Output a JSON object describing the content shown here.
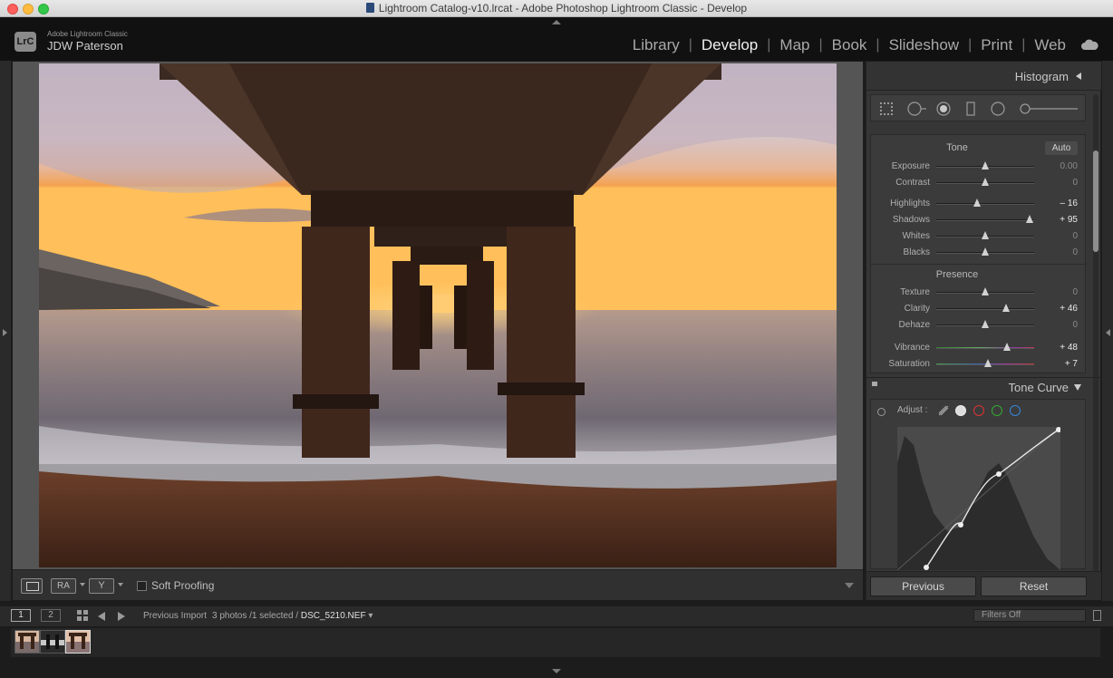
{
  "window": {
    "title": "Lightroom Catalog-v10.lrcat - Adobe Photoshop Lightroom Classic - Develop"
  },
  "identity": {
    "logo": "LrC",
    "product": "Adobe Lightroom Classic",
    "user": "JDW Paterson"
  },
  "modules": [
    {
      "label": "Library",
      "active": false
    },
    {
      "label": "Develop",
      "active": true
    },
    {
      "label": "Map",
      "active": false
    },
    {
      "label": "Book",
      "active": false
    },
    {
      "label": "Slideshow",
      "active": false
    },
    {
      "label": "Print",
      "active": false
    },
    {
      "label": "Web",
      "active": false
    }
  ],
  "toolbar": {
    "compare_label": "RA",
    "survey_label": "Y",
    "soft_proofing": "Soft Proofing"
  },
  "right_panel": {
    "histogram_title": "Histogram",
    "tone": {
      "title": "Tone",
      "auto": "Auto",
      "sliders": [
        {
          "label": "Exposure",
          "value": "0.00",
          "pos": 0.5,
          "changed": false
        },
        {
          "label": "Contrast",
          "value": "0",
          "pos": 0.5,
          "changed": false
        },
        {
          "label": "Highlights",
          "value": "– 16",
          "pos": 0.42,
          "changed": true
        },
        {
          "label": "Shadows",
          "value": "+ 95",
          "pos": 0.95,
          "changed": true
        },
        {
          "label": "Whites",
          "value": "0",
          "pos": 0.5,
          "changed": false
        },
        {
          "label": "Blacks",
          "value": "0",
          "pos": 0.5,
          "changed": false
        }
      ]
    },
    "presence": {
      "title": "Presence",
      "sliders": [
        {
          "label": "Texture",
          "value": "0",
          "pos": 0.5,
          "changed": false
        },
        {
          "label": "Clarity",
          "value": "+ 46",
          "pos": 0.71,
          "changed": true
        },
        {
          "label": "Dehaze",
          "value": "0",
          "pos": 0.5,
          "changed": false
        },
        {
          "label": "Vibrance",
          "value": "+ 48",
          "pos": 0.72,
          "changed": true,
          "style": "vib"
        },
        {
          "label": "Saturation",
          "value": "+ 7",
          "pos": 0.53,
          "changed": true,
          "style": "sat"
        }
      ]
    },
    "tone_curve": {
      "title": "Tone Curve",
      "adjust_label": "Adjust :"
    },
    "buttons": {
      "previous": "Previous",
      "reset": "Reset"
    }
  },
  "filmstrip_bar": {
    "monitor1": "1",
    "monitor2": "2",
    "source": "Previous Import",
    "count": "3 photos /1 selected /",
    "filename": "DSC_5210.NEF",
    "filter": "Filters Off"
  }
}
